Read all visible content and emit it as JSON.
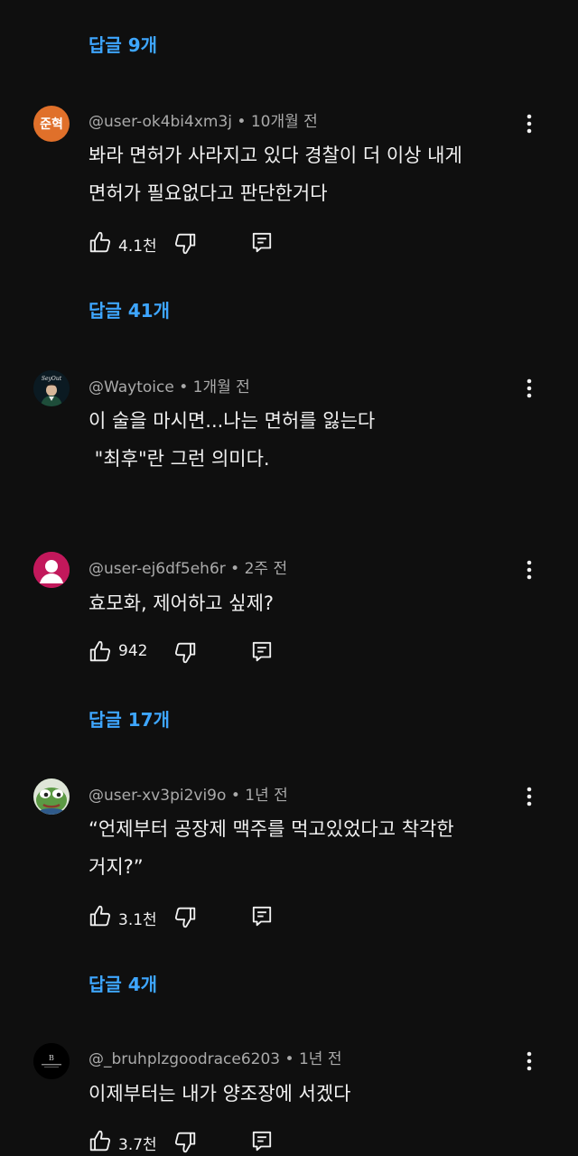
{
  "threads": [
    {
      "reply_link": "답글 9개"
    },
    {
      "avatar": {
        "kind": "text",
        "text": "준혁",
        "bg": "#e0702a"
      },
      "author": "@user-ok4bi4xm3j",
      "time": "10개월 전",
      "lines": [
        "봐라 면허가 사라지고 있다 경찰이 더 이상 내게",
        "면허가 필요없다고 판단한거다"
      ],
      "likes": "4.1천",
      "reply_link": "답글 41개"
    },
    {
      "avatar": {
        "kind": "image",
        "text": "SeyOut",
        "bg": "#0b1a22"
      },
      "author": "@Waytoice",
      "time": "1개월 전",
      "lines": [
        "이 술을 마시면...나는 면허를 잃는다",
        " \"최후\"란 그런 의미다."
      ]
    },
    {
      "avatar": {
        "kind": "default",
        "bg": "#c2185b"
      },
      "author": "@user-ej6df5eh6r",
      "time": "2주 전",
      "lines": [
        "효모화, 제어하고 싶제?"
      ],
      "likes": "942",
      "reply_link": "답글 17개"
    },
    {
      "avatar": {
        "kind": "frog",
        "bg": "#3f6e3a"
      },
      "author": "@user-xv3pi2vi9o",
      "time": "1년 전",
      "lines": [
        "“언제부터 공장제 맥주를 먹고있었다고 착각한",
        "거지?”"
      ],
      "likes": "3.1천",
      "reply_link": "답글 4개"
    },
    {
      "avatar": {
        "kind": "logo",
        "text": "B",
        "bg": "#000000"
      },
      "author": "@_bruhplzgoodrace6203",
      "time": "1년 전",
      "lines": [
        "이제부터는 내가 양조장에 서겠다"
      ],
      "likes": "3.7천"
    }
  ],
  "icons": {
    "like": "thumbs-up-icon",
    "dislike": "thumbs-down-icon",
    "reply": "reply-comment-icon",
    "more": "more-vertical-icon"
  },
  "colors": {
    "background": "#0f0f0f",
    "reply_link": "#3ea6ff",
    "meta": "#aaaaaa",
    "text": "#f1f1f1"
  },
  "separator": "•"
}
